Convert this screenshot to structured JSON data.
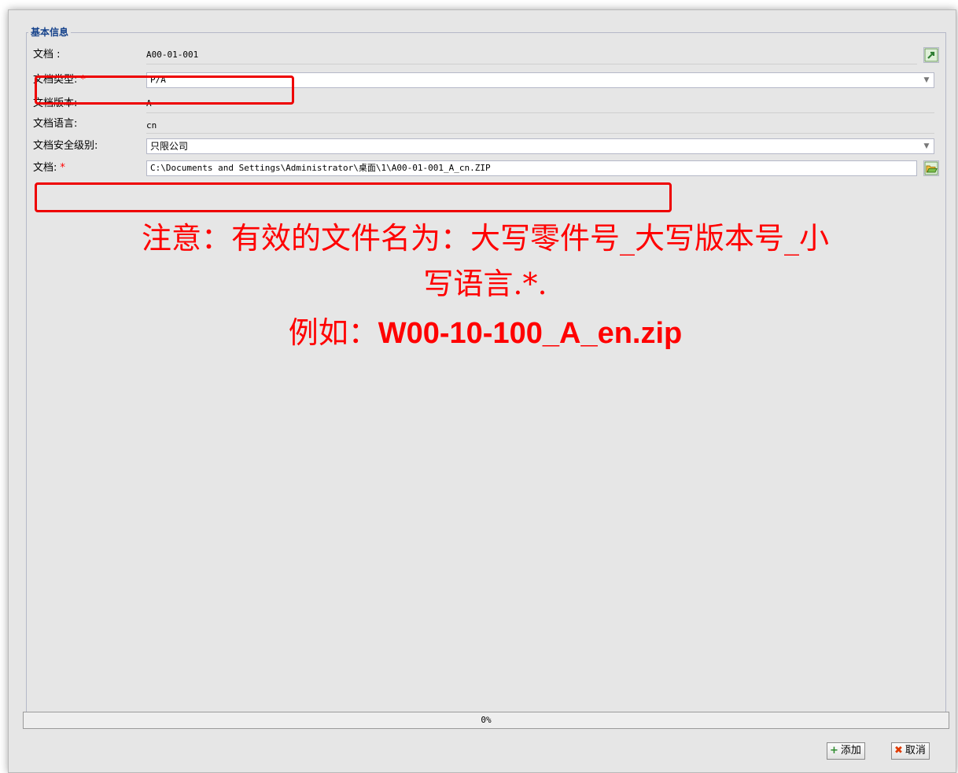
{
  "section": {
    "legend": "基本信息"
  },
  "fields": {
    "doc_number": {
      "label": "文档 :",
      "value": "A00-01-001"
    },
    "doc_type": {
      "label": "文档类型:",
      "required_mark": "*",
      "value": "P/A"
    },
    "doc_version": {
      "label": "文档版本:",
      "value": "A"
    },
    "doc_language": {
      "label": "文档语言:",
      "value": "cn"
    },
    "security_level": {
      "label": "文档安全级别:",
      "value": "只限公司"
    },
    "doc_file": {
      "label": "文档:",
      "required_mark": "*",
      "value": "C:\\Documents and Settings\\Administrator\\桌面\\1\\A00-01-001_A_cn.ZIP"
    }
  },
  "notice": {
    "line1": "注意：有效的文件名为：大写零件号_大写版本号_小",
    "line2": "写语言.*.",
    "example_prefix": "例如：",
    "example_value": "W00-10-100_A_en.zip"
  },
  "progress": {
    "text": "0%",
    "value": 0
  },
  "buttons": {
    "add": "添加",
    "cancel": "取消"
  },
  "icons": {
    "link": "arrow-link-icon",
    "folder": "open-folder-icon",
    "add": "plus-icon",
    "cancel": "x-icon"
  },
  "colors": {
    "highlight": "#ee0000",
    "notice_text": "#ff0000",
    "legend": "#15428b",
    "add_icon": "#2e8b2e",
    "cancel_icon": "#e03a00"
  }
}
